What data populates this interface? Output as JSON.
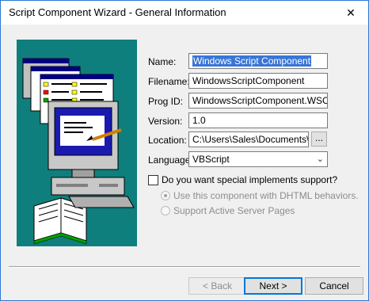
{
  "window": {
    "title": "Script Component Wizard - General Information",
    "close_glyph": "✕"
  },
  "form": {
    "name_label": "Name:",
    "name_value": "Windows Script Component",
    "filename_label": "Filename:",
    "filename_value": "WindowsScriptComponent",
    "progid_label": "Prog ID:",
    "progid_value": "WindowsScriptComponent.WSC",
    "version_label": "Version:",
    "version_value": "1.0",
    "location_label": "Location:",
    "location_value": "C:\\Users\\Sales\\Documents\\SAF",
    "browse_label": "...",
    "language_label": "Language:",
    "language_value": "VBScript",
    "special_checkbox_label": "Do you want special implements support?",
    "special_checked": false,
    "radio_dhtml_label": "Use this component with DHTML behaviors.",
    "radio_asp_label": "Support Active Server Pages"
  },
  "buttons": {
    "back": "< Back",
    "next": "Next >",
    "cancel": "Cancel"
  },
  "colors": {
    "illustration_bg": "#0f7f7d",
    "selection": "#3875d7",
    "default_button_border": "#0078d7"
  },
  "icons": {
    "illustration": "computer-with-book-illustration",
    "combo_arrow": "chevron-down-icon"
  }
}
